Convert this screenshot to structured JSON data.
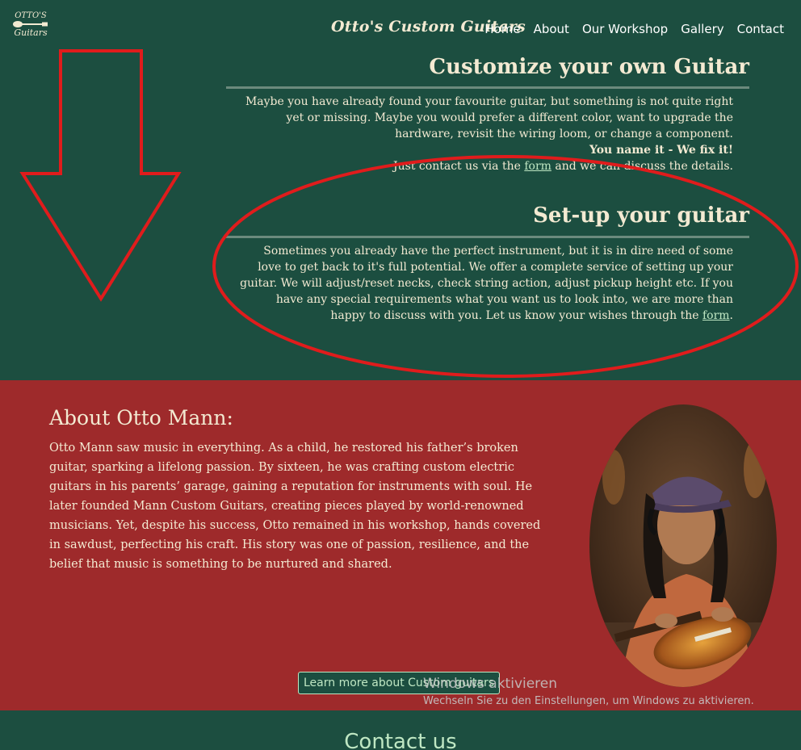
{
  "header": {
    "logo_line1": "OTTO'S",
    "logo_line2": "Guitars",
    "brand": "Otto's Custom Guitars",
    "nav": [
      "Home",
      "About",
      "Our Workshop",
      "Gallery",
      "Contact"
    ]
  },
  "customize": {
    "title": "Customize your own Guitar",
    "line1": "Maybe you have already found your favourite guitar, but something is not quite right",
    "line2": "yet or missing. Maybe you would prefer a different color, want to upgrade the",
    "line3": "hardware, revisit the wiring loom, or change a component.",
    "line4_bold": "You name it - We fix it!",
    "line5_pre": "Just contact us via the",
    "line5_link": "form",
    "line5_post": "and we can discuss the details."
  },
  "setup": {
    "title": "Set-up your guitar",
    "line1": "Sometimes you already have the perfect instrument, but it is in dire need of some",
    "line2": "love to get back to it's full potential. We offer a complete service of setting up your",
    "line3": "guitar. We will adjust/reset necks, check string action, adjust pickup height etc. If you",
    "line4": "have any special requirements what you want us to look into, we are more than",
    "line5_pre": "happy to discuss with you. Let us know your wishes through the",
    "line5_link": "form",
    "line5_post": "."
  },
  "about": {
    "title": "About Otto Mann:",
    "text": "Otto Mann saw music in everything. As a child, he restored his father’s broken guitar, sparking a lifelong passion. By sixteen, he was crafting custom electric guitars in his parents’ garage, gaining a reputation for instruments with soul. He later founded Mann Custom Guitars, creating pieces played by world-renowned musicians. Yet, despite his success, Otto remained in his workshop, hands covered in sawdust, perfecting his craft. His story was one of passion, resilience, and the belief that music is something to be nurtured and shared.",
    "button": "Learn more about Custom guitars"
  },
  "watermark": {
    "line1": "Windows aktivieren",
    "line2": "Wechseln Sie zu den Einstellungen, um Windows zu aktivieren."
  },
  "contact": {
    "title": "Contact us"
  },
  "colors": {
    "green": "#1c4e40",
    "red": "#9e2a2b",
    "cream": "#f3ead2",
    "mint": "#bfe7c3",
    "annotation": "#e01c1c"
  }
}
